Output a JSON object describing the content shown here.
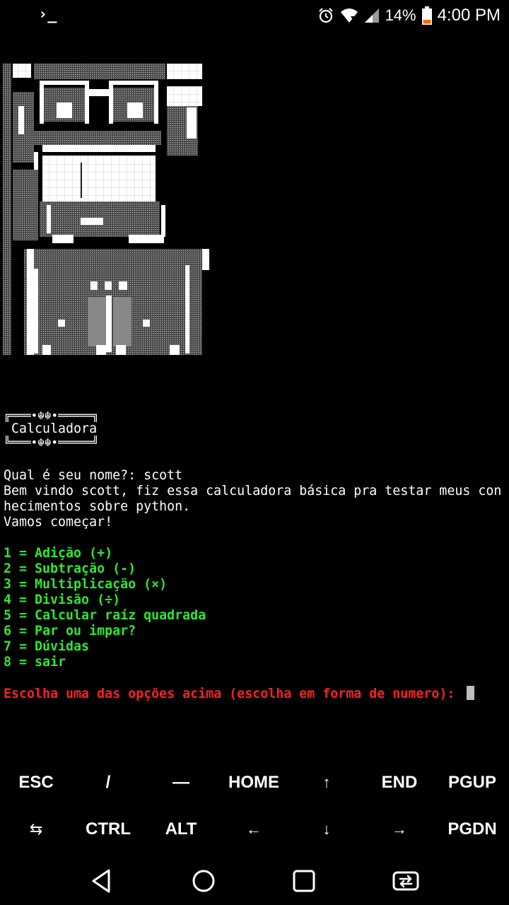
{
  "status_bar": {
    "app_icon": "terminal-icon",
    "battery": "14%",
    "time": "4:00 PM",
    "icons": [
      "alarm-icon",
      "wifi-icon",
      "cell-signal-icon",
      "battery-icon"
    ]
  },
  "terminal": {
    "banner_top": "╔═══•☬☬•═════╗",
    "banner_title": " Calculadora",
    "banner_bottom": "╚═══•☬☬•═════╝",
    "prompt_name": "Qual é seu nome?: scott",
    "welcome_1": "Bem vindo scott, fiz essa calculadora básica pra testar meus con",
    "welcome_2": "hecimentos sobre python.",
    "start": "Vamos começar!",
    "menu": [
      "1 = Adição (+)",
      "2 = Subtração (-)",
      "3 = Multiplicação (×)",
      "4 = Divisão (÷)",
      "5 = Calcular raíz quadrada",
      "6 = Par ou impar?",
      "7 = Dúvidas",
      "8 = sair"
    ],
    "input_prompt": "Escolha uma das opções acima (escolha em forma de numero): "
  },
  "extra_keys": {
    "row1": [
      "ESC",
      "/",
      "—",
      "HOME",
      "↑",
      "END",
      "PGUP"
    ],
    "row2": [
      "⇆",
      "CTRL",
      "ALT",
      "←",
      "↓",
      "→",
      "PGDN"
    ]
  },
  "nav": {
    "buttons": [
      "back-icon",
      "home-icon",
      "recents-icon",
      "switch-app-icon"
    ]
  },
  "colors": {
    "background": "#000000",
    "menu_text": "#2fe82f",
    "prompt_text": "#ff2020",
    "cursor": "#bdbdbd"
  }
}
